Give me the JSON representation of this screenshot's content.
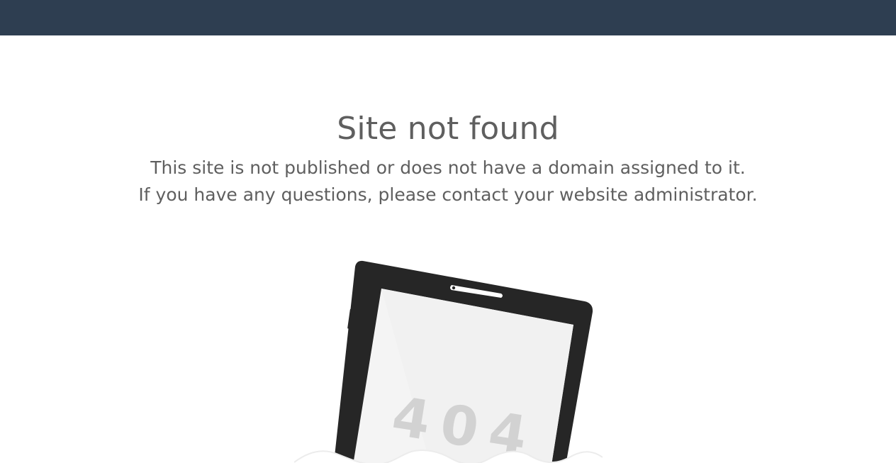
{
  "header": {
    "color": "#2e3e51"
  },
  "main": {
    "title": "Site not found",
    "message_line_1": "This site is not published or does not have a domain assigned to it.",
    "message_line_2": "If you have any questions, please contact your website administrator."
  },
  "illustration": {
    "screen_text": "404",
    "icon": "tablet-404-icon",
    "colors": {
      "tablet": "#262626",
      "screen": "#f4f4f4",
      "digits": "#d2d2d2",
      "water": "#ffffff"
    }
  }
}
